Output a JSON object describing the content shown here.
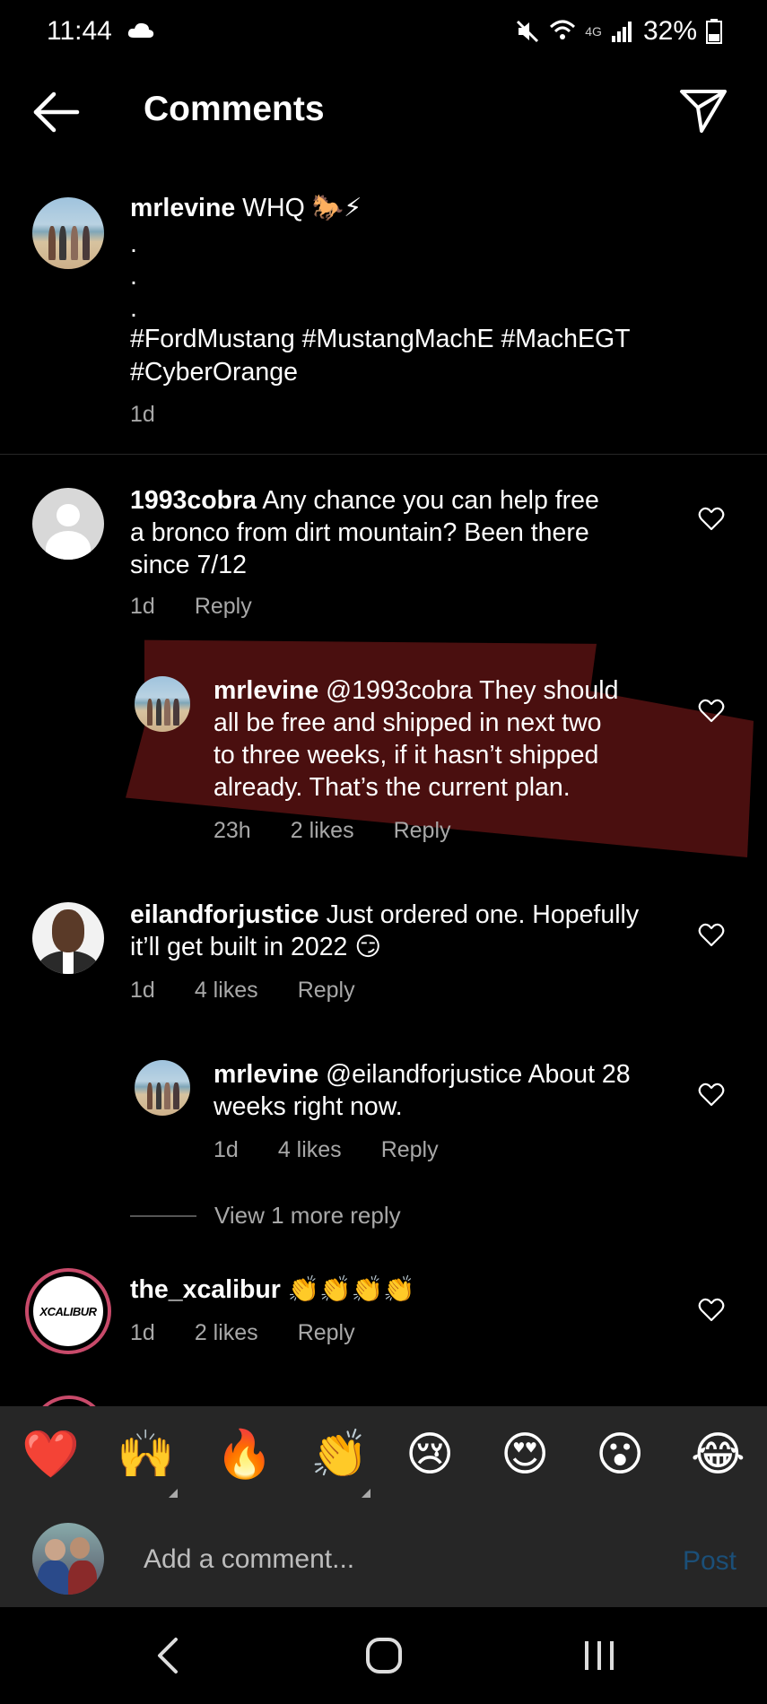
{
  "status_bar": {
    "time": "11:44",
    "battery": "32%",
    "network": "4G"
  },
  "header": {
    "title": "Comments"
  },
  "caption": {
    "user": "mrlevine",
    "text_first": "WHQ 🐎⚡",
    "dots": ".",
    "hashtags_line1": "#FordMustang #MustangMachE #MachEGT",
    "hashtags_line2": "#CyberOrange",
    "time": "1d"
  },
  "comments": [
    {
      "user": "1993cobra",
      "line1": "Any chance you can help free",
      "line2": "a bronco from dirt mountain? Been there",
      "line3": "since 7/12",
      "time": "1d",
      "reply": "Reply"
    },
    {
      "user": "mrlevine",
      "line1": "@1993cobra They should",
      "line2": "all be free and shipped in next two",
      "line3": "to three weeks, if it hasn’t shipped",
      "line4": "already. That’s the current plan.",
      "time": "23h",
      "likes": "2 likes",
      "reply": "Reply"
    },
    {
      "user": "eilandforjustice",
      "line1": "Just ordered one. Hopefully",
      "line2": "it’ll get built in 2022 😏",
      "time": "1d",
      "likes": "4 likes",
      "reply": "Reply"
    },
    {
      "user": "mrlevine",
      "line1": "@eilandforjustice About 28",
      "line2": "weeks right now.",
      "time": "1d",
      "likes": "4 likes",
      "reply": "Reply"
    },
    {
      "user": "the_xcalibur",
      "line1": "👏👏👏👏",
      "time": "1d",
      "likes": "2 likes",
      "reply": "Reply",
      "avatar_logo": "XCALIBUR"
    }
  ],
  "view_more": "View 1 more reply",
  "emoji_bar": [
    "❤️",
    "🙌",
    "🔥",
    "👏",
    "😢",
    "😍",
    "😮",
    "😂"
  ],
  "input": {
    "placeholder": "Add a comment...",
    "post_label": "Post"
  },
  "colors": {
    "highlight": "#7a1818",
    "post_disabled": "#1b4f78",
    "muted_text": "#a8a8a8"
  }
}
